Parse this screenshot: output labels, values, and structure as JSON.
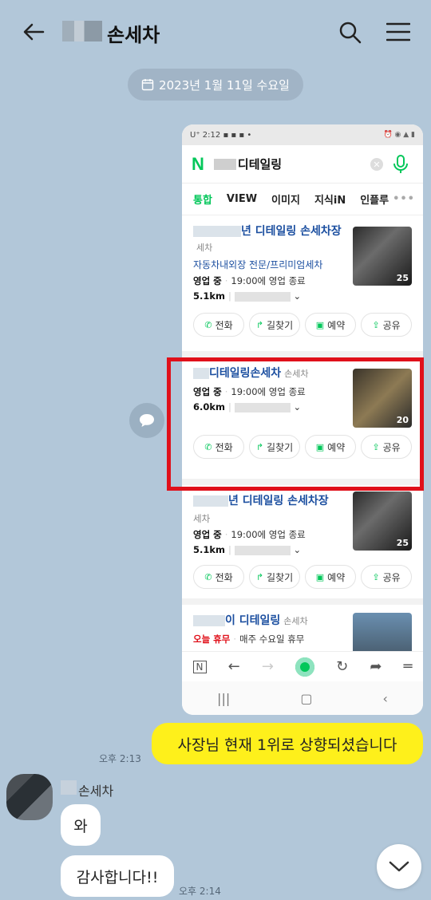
{
  "header": {
    "chat_title": "손세차",
    "icons": [
      "back-arrow-icon",
      "search-icon",
      "menu-icon"
    ]
  },
  "date_divider": "2023년 1월 11일 수요일",
  "screenshot": {
    "status_time": "2:12",
    "status_extra": "U⁺",
    "naver_logo": "N",
    "query": "디테일링",
    "tabs": [
      "통합",
      "VIEW",
      "이미지",
      "지식iN",
      "인플루"
    ],
    "cards": [
      {
        "name": "년 디테일링 손세차장",
        "category": "세차",
        "subtitle": "자동차내외장 전문/프리미엄세차",
        "status": "영업 중",
        "hours": "19:00에 영업 종료",
        "distance": "5.1km",
        "photo_count": "25"
      },
      {
        "name": "디테일링손세차",
        "category": "손세차",
        "status": "영업 중",
        "hours": "19:00에 영업 종료",
        "distance": "6.0km",
        "photo_count": "20"
      },
      {
        "name": "년 디테일링 손세차장",
        "category": "세차",
        "status": "영업 중",
        "hours": "19:00에 영업 종료",
        "distance": "5.1km",
        "photo_count": "25"
      },
      {
        "name": "이 디테일링",
        "category": "손세차",
        "status": "오늘 휴무",
        "hours": "매주 수요일 휴무"
      }
    ],
    "action_buttons": [
      "전화",
      "길찾기",
      "예약",
      "공유"
    ]
  },
  "messages": {
    "me": {
      "text": "사장님 현재 1위로 상향되셨습니다",
      "time": "오후 2:13"
    },
    "sender_name": "손세차",
    "them": [
      {
        "text": "와"
      },
      {
        "text": "감사합니다!!",
        "time": "오후 2:14"
      }
    ]
  },
  "colors": {
    "chat_bg": "#b2c7d9",
    "my_bubble": "#fef01b",
    "naver_green": "#03c75a",
    "highlight": "#e0101a"
  }
}
